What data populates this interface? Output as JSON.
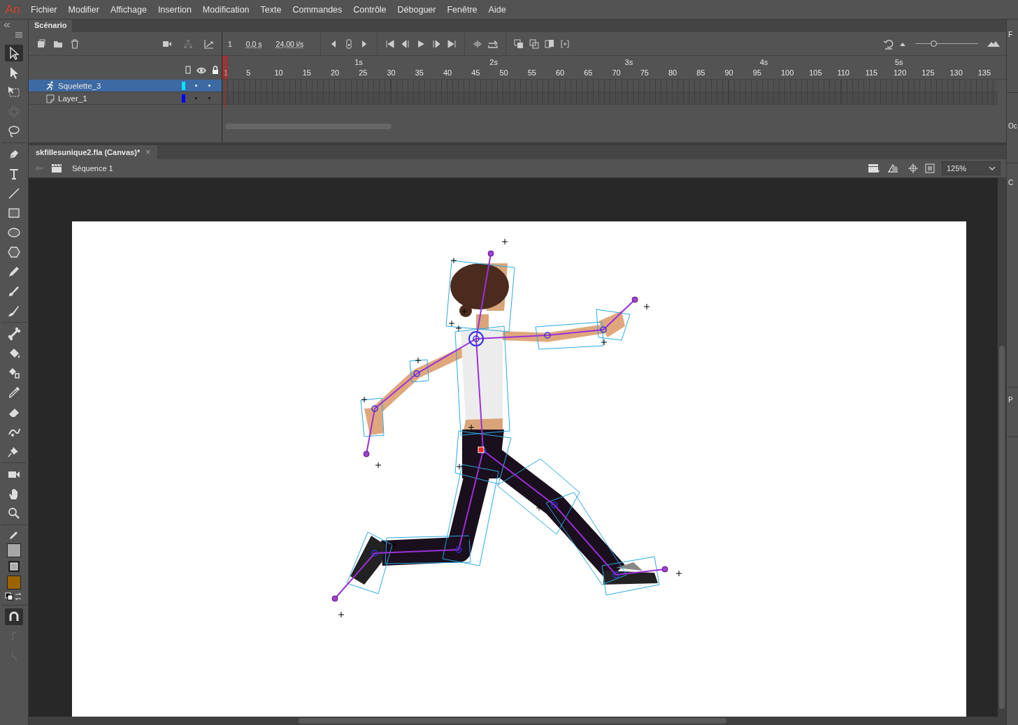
{
  "app": {
    "logo": "An"
  },
  "menu": [
    "Fichier",
    "Modifier",
    "Affichage",
    "Insertion",
    "Modification",
    "Texte",
    "Commandes",
    "Contrôle",
    "Déboguer",
    "Fenêtre",
    "Aide"
  ],
  "timeline": {
    "tab": "Scénario",
    "current_frame": "1",
    "time": "0,0 s",
    "fps": "24,00 i/s",
    "zoom_slider": {
      "level": 0.3
    },
    "seconds": [
      "1s",
      "2s",
      "3s",
      "4s",
      "5s"
    ],
    "frames": [
      "1",
      "5",
      "10",
      "15",
      "20",
      "25",
      "30",
      "35",
      "40",
      "45",
      "50",
      "55",
      "60",
      "65",
      "70",
      "75",
      "80",
      "85",
      "90",
      "95",
      "100",
      "105",
      "110",
      "115",
      "120",
      "125",
      "130",
      "135"
    ],
    "layers": [
      {
        "name": "Squelette_3",
        "kind": "armature",
        "selected": true,
        "color": "#00e5ff"
      },
      {
        "name": "Layer_1",
        "kind": "layer",
        "selected": false,
        "color": "#0000ff"
      }
    ]
  },
  "document": {
    "tab": "skfillesunique2.fla (Canvas)*",
    "close": "×",
    "scene": "Séquence 1",
    "zoom": "125%"
  },
  "tool_groups": [
    [
      {
        "kind": "selection",
        "selected": true,
        "disabled": false
      },
      {
        "kind": "subselection",
        "selected": false,
        "disabled": false
      },
      {
        "kind": "free-transform",
        "selected": false,
        "disabled": false
      },
      {
        "kind": "rotation-3d",
        "selected": false,
        "disabled": true
      },
      {
        "kind": "lasso",
        "selected": false,
        "disabled": false
      }
    ],
    [
      {
        "kind": "pen",
        "selected": false,
        "disabled": false
      },
      {
        "kind": "text",
        "selected": false,
        "disabled": false
      },
      {
        "kind": "line",
        "selected": false,
        "disabled": false
      },
      {
        "kind": "rectangle",
        "selected": false,
        "disabled": false
      },
      {
        "kind": "oval",
        "selected": false,
        "disabled": false
      },
      {
        "kind": "polystar",
        "selected": false,
        "disabled": false
      },
      {
        "kind": "pencil",
        "selected": false,
        "disabled": false
      },
      {
        "kind": "paint-brush",
        "selected": false,
        "disabled": false
      },
      {
        "kind": "brush",
        "selected": false,
        "disabled": false
      }
    ],
    [
      {
        "kind": "bone",
        "selected": false,
        "disabled": false
      },
      {
        "kind": "paint-bucket",
        "selected": false,
        "disabled": false
      },
      {
        "kind": "ink-bottle",
        "selected": false,
        "disabled": false
      },
      {
        "kind": "eyedropper",
        "selected": false,
        "disabled": false
      },
      {
        "kind": "eraser",
        "selected": false,
        "disabled": false
      },
      {
        "kind": "width",
        "selected": false,
        "disabled": false
      },
      {
        "kind": "pin",
        "selected": false,
        "disabled": false
      }
    ],
    [
      {
        "kind": "camera",
        "selected": false,
        "disabled": false
      },
      {
        "kind": "hand",
        "selected": false,
        "disabled": false
      },
      {
        "kind": "zoom",
        "selected": false,
        "disabled": false
      }
    ]
  ],
  "options": [
    {
      "kind": "snap",
      "selected": true
    },
    {
      "kind": "smooth",
      "selected": false
    },
    {
      "kind": "straighten",
      "selected": false
    }
  ],
  "side_panel": {
    "labels": [
      "F",
      "Oc",
      "C",
      "P"
    ]
  }
}
